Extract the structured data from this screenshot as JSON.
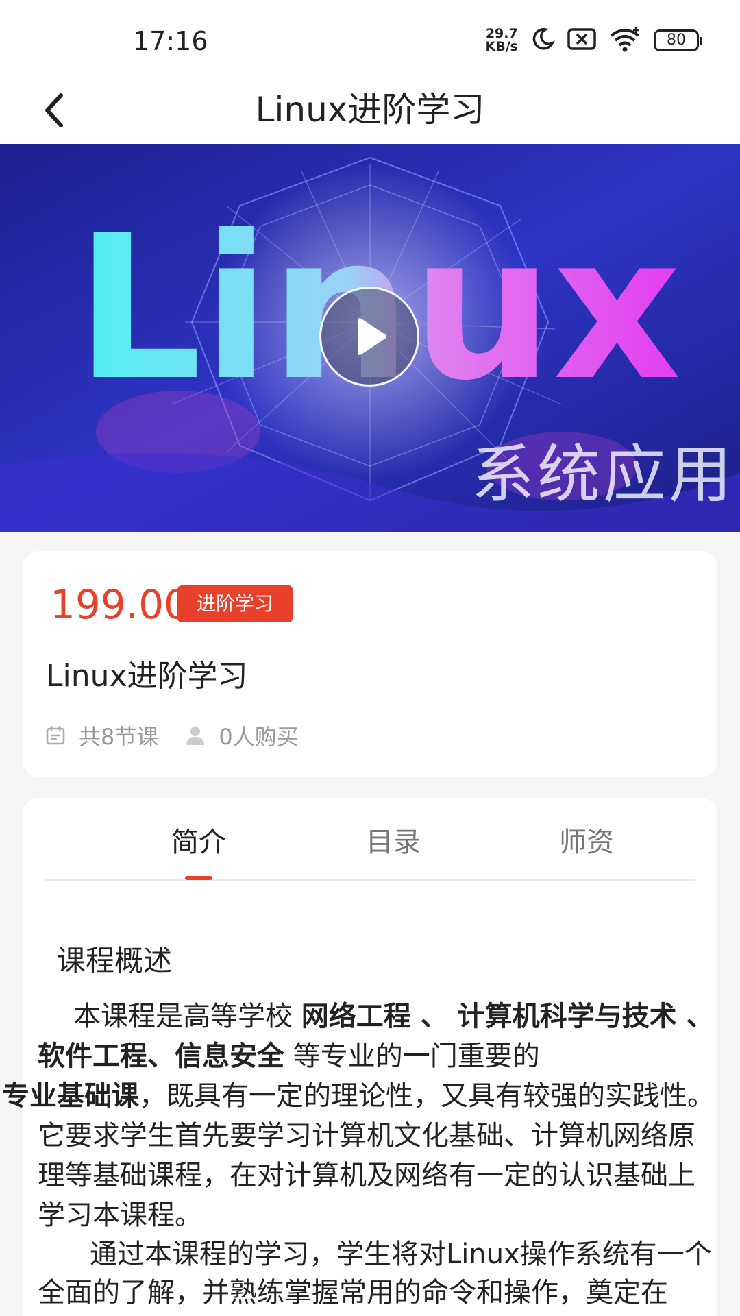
{
  "status_bar": {
    "time": "17:16",
    "net_speed_value": "29.7",
    "net_speed_unit": "KB/s",
    "battery": "80",
    "icons": [
      "moon-icon",
      "sim-x-icon",
      "wifi-icon",
      "battery-icon"
    ]
  },
  "nav": {
    "title": "Linux进阶学习",
    "back_icon": "chevron-left-icon"
  },
  "banner": {
    "big_text": "Linux",
    "sub_text": "系统应用",
    "play_icon": "play-icon"
  },
  "course": {
    "price": "199.00",
    "level_badge": "进阶学习",
    "title": "Linux进阶学习",
    "lessons": "共8节课",
    "buyers": "0人购买"
  },
  "tabs": [
    {
      "label": "简介",
      "active": true
    },
    {
      "label": "目录",
      "active": false
    },
    {
      "label": "师资",
      "active": false
    }
  ],
  "intro": {
    "section_title": "课程概述",
    "p1_a": "本课程是高等学校 ",
    "p1_b": "网络工程 、 计算机科学与技术 、 软件工程、信息安全",
    "p1_c": " 等专业的一门重要的",
    "p1_d": "专业基础课",
    "p1_e": "，既具有一定的理论性，又具有较强的实践性。它要求学生首先要学习计算机文化基础、计算机网络原理等基础课程，在对计算机及网络有一定的认识基础上学习本课程。",
    "p2": "通过本课程的学习，学生将对Linux操作系统有一个全面的了解，并熟练掌握常用的命令和操作，奠定在"
  },
  "colors": {
    "accent": "#e8402a",
    "banner_bg": "#2a2fb8"
  }
}
